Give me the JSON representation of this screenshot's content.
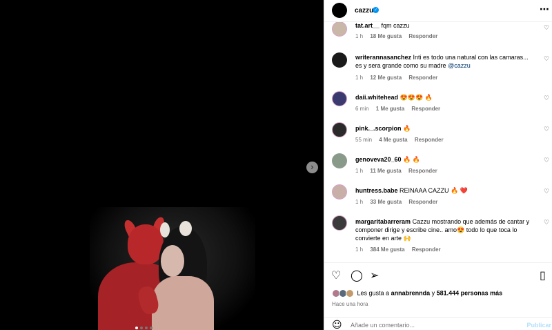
{
  "post": {
    "username": "cazzu",
    "verified": true
  },
  "comments": [
    {
      "user": "tat.art__",
      "text": "fqm cazzu",
      "time": "1 h",
      "likes": "18 Me gusta",
      "reply": "Responder",
      "avatar_color": "#c9b7a8"
    },
    {
      "user": "writerannasanchez",
      "text": "Inti es todo una natural con las camaras... es y sera grande como su madre",
      "mention": "@cazzu",
      "time": "1 h",
      "likes": "12 Me gusta",
      "reply": "Responder",
      "avatar_color": "#1a1a1a"
    },
    {
      "user": "daii.whitehead",
      "text": "😍😍😍 🔥",
      "time": "6 min",
      "likes": "1 Me gusta",
      "reply": "Responder",
      "avatar_color": "#3b3a6e"
    },
    {
      "user": "pink._.scorpion",
      "text": "🔥",
      "time": "55 min",
      "likes": "4 Me gusta",
      "reply": "Responder",
      "avatar_color": "#2a2a2a"
    },
    {
      "user": "genoveva20_60",
      "text": "🔥 🔥",
      "time": "1 h",
      "likes": "11 Me gusta",
      "reply": "Responder",
      "avatar_color": "#8a9a8a"
    },
    {
      "user": "huntress.babe",
      "text": "REINAAA CAZZU 🔥 ❤️",
      "time": "1 h",
      "likes": "33 Me gusta",
      "reply": "Responder",
      "avatar_color": "#c8b0a8"
    },
    {
      "user": "margaritabarreram",
      "text": "Cazzu mostrando que además de cantar y componer dirige y escribe cine.. amo😍  todo lo que toca lo convierte en arte 🙌",
      "time": "1 h",
      "likes": "384 Me gusta",
      "reply": "Responder",
      "avatar_color": "#3a3a3a"
    }
  ],
  "likes_line": {
    "prefix": "Les gusta a",
    "user": "annabrennda",
    "connector": "y",
    "others": "581.444 personas más"
  },
  "time_ago": "Hace una hora",
  "add_comment": {
    "placeholder": "Añade un comentario...",
    "publish_label": "Publicar"
  },
  "icons": {
    "like": "heart-icon",
    "comment": "comment-icon",
    "share": "share-icon",
    "save": "bookmark-icon",
    "more": "more-icon",
    "emoji": "emoji-icon",
    "next": "chevron-right-icon"
  },
  "colors": {
    "link": "#00376b",
    "verified": "#0095f6",
    "publish_disabled": "#b2dffc",
    "meta": "#737373"
  }
}
